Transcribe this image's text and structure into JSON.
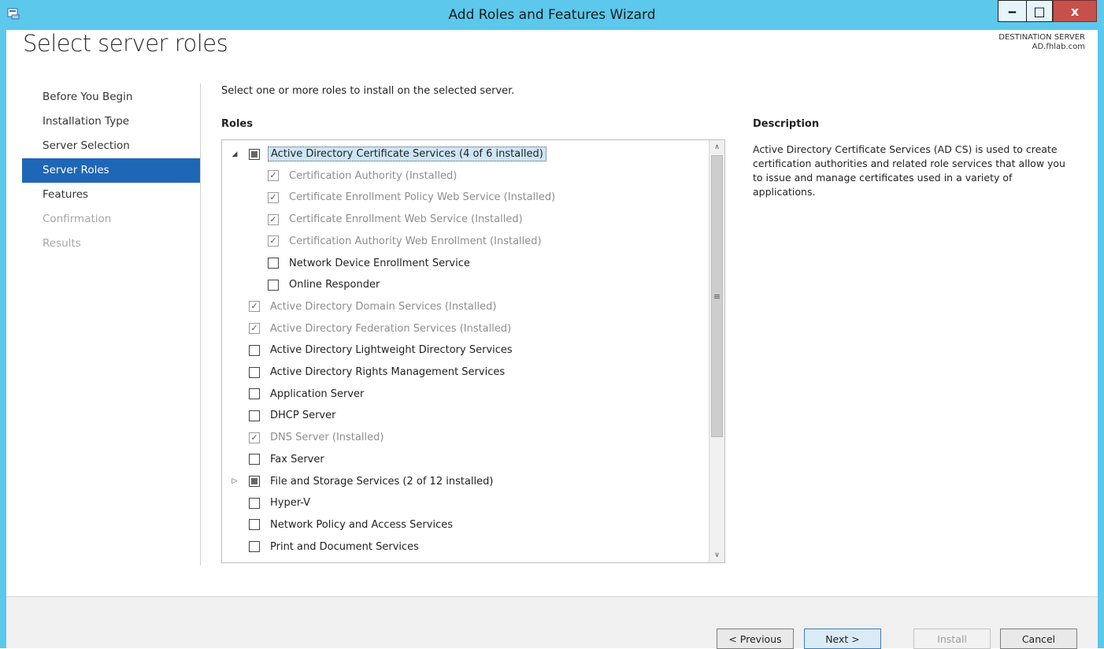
{
  "window": {
    "title": "Add Roles and Features Wizard",
    "minimize_glyph": "‒",
    "maximize_glyph": "□",
    "close_glyph": "x"
  },
  "page": {
    "title": "Select server roles",
    "destination_label": "DESTINATION SERVER",
    "destination_server": "AD.fhlab.com"
  },
  "nav": {
    "items": [
      {
        "label": "Before You Begin",
        "state": "normal"
      },
      {
        "label": "Installation Type",
        "state": "normal"
      },
      {
        "label": "Server Selection",
        "state": "normal"
      },
      {
        "label": "Server Roles",
        "state": "active"
      },
      {
        "label": "Features",
        "state": "normal"
      },
      {
        "label": "Confirmation",
        "state": "disabled"
      },
      {
        "label": "Results",
        "state": "disabled"
      }
    ]
  },
  "main": {
    "instruction": "Select one or more roles to install on the selected server.",
    "roles_heading": "Roles",
    "description_heading": "Description",
    "description_text": "Active Directory Certificate Services (AD CS) is used to create certification authorities and related role services that allow you to issue and manage certificates used in a variety of applications."
  },
  "roles": [
    {
      "label": "Active Directory Certificate Services (4 of 6 installed)",
      "level": 0,
      "expander": "expanded",
      "check": "partial",
      "dim": false,
      "selected": true
    },
    {
      "label": "Certification Authority (Installed)",
      "level": 1,
      "expander": "",
      "check": "checked-gray",
      "dim": true,
      "selected": false
    },
    {
      "label": "Certificate Enrollment Policy Web Service (Installed)",
      "level": 1,
      "expander": "",
      "check": "checked-gray",
      "dim": true,
      "selected": false
    },
    {
      "label": "Certificate Enrollment Web Service (Installed)",
      "level": 1,
      "expander": "",
      "check": "checked-gray",
      "dim": true,
      "selected": false
    },
    {
      "label": "Certification Authority Web Enrollment (Installed)",
      "level": 1,
      "expander": "",
      "check": "checked-gray",
      "dim": true,
      "selected": false
    },
    {
      "label": "Network Device Enrollment Service",
      "level": 1,
      "expander": "",
      "check": "unchecked",
      "dim": false,
      "selected": false
    },
    {
      "label": "Online Responder",
      "level": 1,
      "expander": "",
      "check": "unchecked",
      "dim": false,
      "selected": false
    },
    {
      "label": "Active Directory Domain Services (Installed)",
      "level": 0,
      "expander": "",
      "check": "checked-gray",
      "dim": true,
      "selected": false
    },
    {
      "label": "Active Directory Federation Services (Installed)",
      "level": 0,
      "expander": "",
      "check": "checked-gray",
      "dim": true,
      "selected": false
    },
    {
      "label": "Active Directory Lightweight Directory Services",
      "level": 0,
      "expander": "",
      "check": "unchecked",
      "dim": false,
      "selected": false
    },
    {
      "label": "Active Directory Rights Management Services",
      "level": 0,
      "expander": "",
      "check": "unchecked",
      "dim": false,
      "selected": false
    },
    {
      "label": "Application Server",
      "level": 0,
      "expander": "",
      "check": "unchecked",
      "dim": false,
      "selected": false
    },
    {
      "label": "DHCP Server",
      "level": 0,
      "expander": "",
      "check": "unchecked",
      "dim": false,
      "selected": false
    },
    {
      "label": "DNS Server (Installed)",
      "level": 0,
      "expander": "",
      "check": "checked-gray",
      "dim": true,
      "selected": false
    },
    {
      "label": "Fax Server",
      "level": 0,
      "expander": "",
      "check": "unchecked",
      "dim": false,
      "selected": false
    },
    {
      "label": "File and Storage Services (2 of 12 installed)",
      "level": 0,
      "expander": "collapsed",
      "check": "partial",
      "dim": false,
      "selected": false
    },
    {
      "label": "Hyper-V",
      "level": 0,
      "expander": "",
      "check": "unchecked",
      "dim": false,
      "selected": false
    },
    {
      "label": "Network Policy and Access Services",
      "level": 0,
      "expander": "",
      "check": "unchecked",
      "dim": false,
      "selected": false
    },
    {
      "label": "Print and Document Services",
      "level": 0,
      "expander": "",
      "check": "unchecked",
      "dim": false,
      "selected": false
    }
  ],
  "buttons": {
    "previous": "< Previous",
    "next": "Next >",
    "install": "Install",
    "cancel": "Cancel"
  },
  "colors": {
    "titlebar": "#5bc8ec",
    "nav_active": "#1e66b6",
    "selection": "#cde6f7",
    "close_button": "#c7504b"
  }
}
